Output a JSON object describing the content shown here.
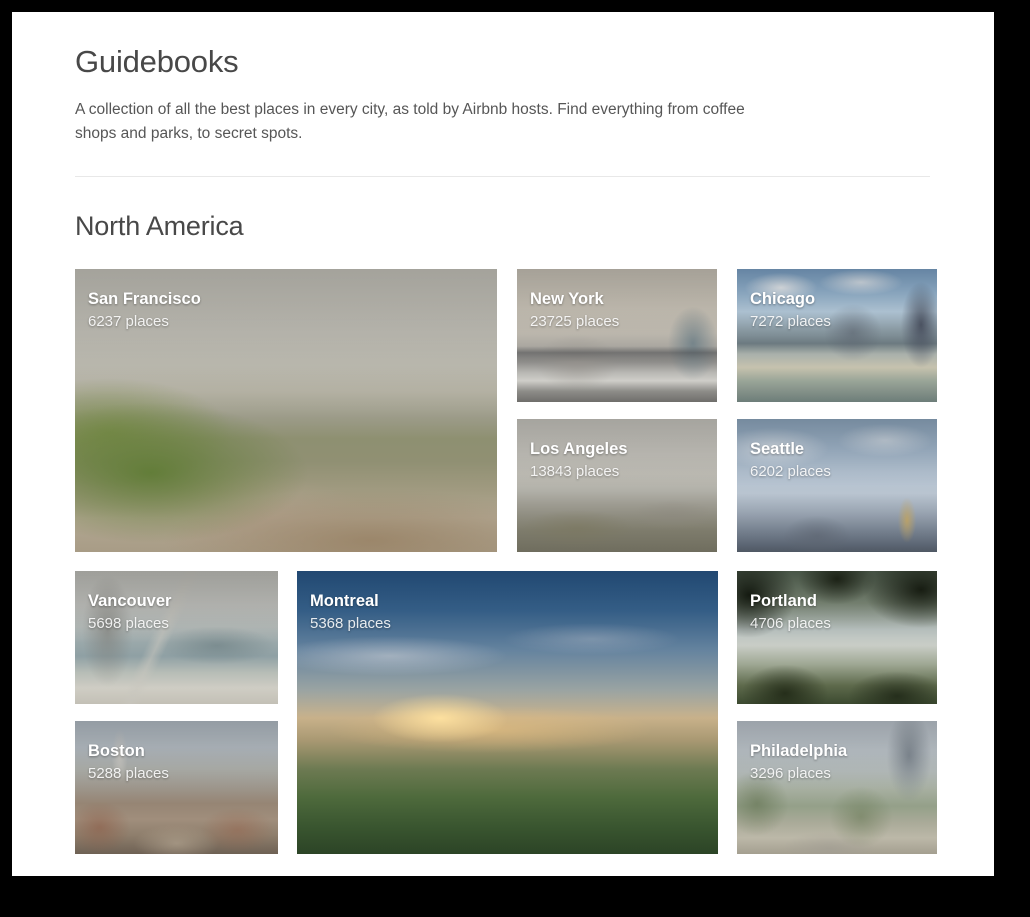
{
  "header": {
    "title": "Guidebooks",
    "subtitle": "A collection of all the best places in every city, as told by Airbnb hosts. Find everything from coffee shops and parks, to secret spots."
  },
  "section": {
    "title": "North America"
  },
  "cards": [
    {
      "city": "San Francisco",
      "places": "6237 places"
    },
    {
      "city": "New York",
      "places": "23725 places"
    },
    {
      "city": "Chicago",
      "places": "7272 places"
    },
    {
      "city": "Los Angeles",
      "places": "13843 places"
    },
    {
      "city": "Seattle",
      "places": "6202 places"
    },
    {
      "city": "Vancouver",
      "places": "5698 places"
    },
    {
      "city": "Montreal",
      "places": "5368 places"
    },
    {
      "city": "Portland",
      "places": "4706 places"
    },
    {
      "city": "Boston",
      "places": "5288 places"
    },
    {
      "city": "Philadelphia",
      "places": "3296 places"
    }
  ],
  "colors": {
    "page_background": "#ffffff",
    "frame": "#000000",
    "title_text": "#484848",
    "body_text": "#565656",
    "divider": "#e8e8e8",
    "card_label": "#ffffff"
  }
}
